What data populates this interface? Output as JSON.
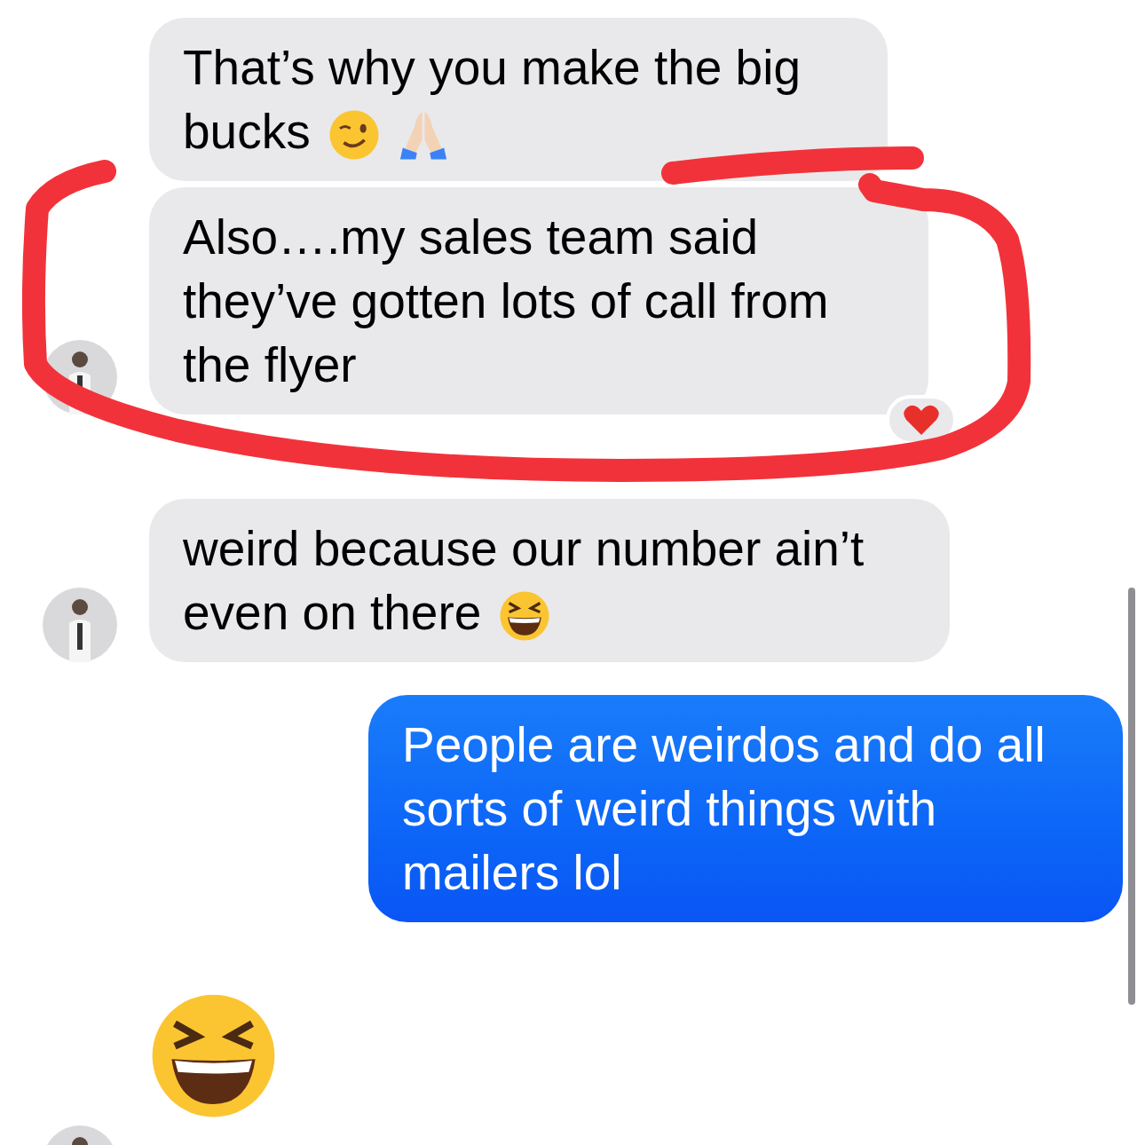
{
  "messages": [
    {
      "kind": "incoming",
      "text": "That’s why you make the big bucks",
      "emoji": [
        {
          "kind": "wink"
        },
        {
          "kind": "pray"
        }
      ],
      "avatar": false,
      "reacted": false
    },
    {
      "kind": "incoming",
      "text": "Also….my sales team said they’ve gotten lots of call from the flyer",
      "avatar": true,
      "reacted": true
    },
    {
      "kind": "incoming",
      "text": "weird because our number ain’t even on there",
      "emoji": [
        {
          "kind": "laugh"
        }
      ],
      "avatar": true,
      "reacted": false
    },
    {
      "kind": "outgoing",
      "text": "People are weirdos and do all sorts of weird things with mailers lol",
      "avatar": false,
      "reacted": false
    },
    {
      "kind": "big-emoji",
      "emoji": [
        {
          "kind": "laugh"
        }
      ],
      "avatar": true,
      "reacted": false
    }
  ]
}
